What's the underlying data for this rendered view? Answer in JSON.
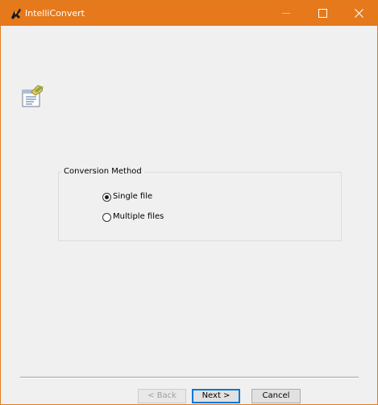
{
  "window": {
    "title": "IntelliConvert",
    "accent_color": "#e5791c"
  },
  "titlebar_controls": {
    "minimize_icon": "minimize-icon",
    "maximize_icon": "maximize-icon",
    "close_icon": "close-icon",
    "close_glyph": "✕"
  },
  "conversion_method": {
    "legend": "Conversion Method",
    "options": [
      {
        "label": "Single file",
        "selected": true
      },
      {
        "label": "Multiple files",
        "selected": false
      }
    ]
  },
  "buttons": {
    "back": "< Back",
    "next": "Next >",
    "cancel": "Cancel"
  }
}
